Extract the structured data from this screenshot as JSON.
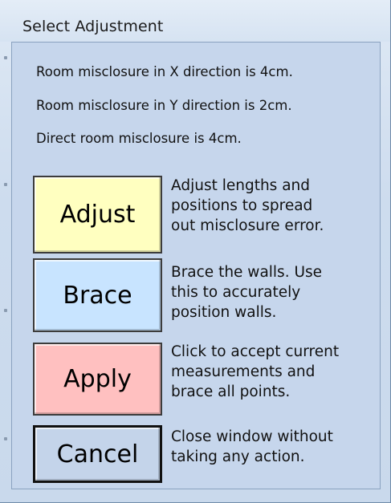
{
  "window": {
    "title": "Select Adjustment"
  },
  "messages": [
    "Room misclosure in X direction is 4cm.",
    "Room misclosure in Y direction is 2cm.",
    "Direct room misclosure is 4cm."
  ],
  "actions": [
    {
      "label": "Adjust",
      "description": "Adjust lengths and\npositions to spread\nout misclosure error.",
      "color": "#ffffc0"
    },
    {
      "label": "Brace",
      "description": "Brace the walls.  Use\nthis to accurately\nposition walls.",
      "color": "#c8e4ff"
    },
    {
      "label": "Apply",
      "description": "Click to accept current\nmeasurements and\nbrace all points.",
      "color": "#ffc0c0"
    },
    {
      "label": "Cancel",
      "description": "Close window without\ntaking any action.",
      "color": "#c4d4ea"
    }
  ]
}
